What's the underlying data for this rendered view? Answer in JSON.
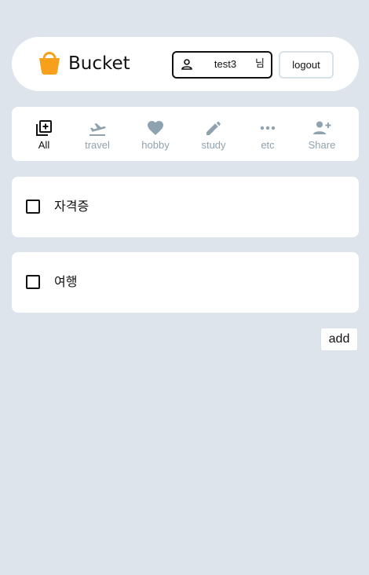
{
  "header": {
    "logo_icon": "bucket-icon",
    "logo_text": "Bucket",
    "user": {
      "icon": "person-icon",
      "name": "test3",
      "suffix": "님"
    },
    "logout_label": "logout"
  },
  "categories": [
    {
      "label": "All",
      "icon": "add-box-icon",
      "active": true
    },
    {
      "label": "travel",
      "icon": "airplane-takeoff-icon",
      "active": false
    },
    {
      "label": "hobby",
      "icon": "heart-icon",
      "active": false
    },
    {
      "label": "study",
      "icon": "pencil-icon",
      "active": false
    },
    {
      "label": "etc",
      "icon": "more-horizontal-icon",
      "active": false
    },
    {
      "label": "Share",
      "icon": "person-add-icon",
      "active": false
    }
  ],
  "items": [
    {
      "text": "자격증",
      "checked": false
    },
    {
      "text": "여행",
      "checked": false
    }
  ],
  "add_label": "add",
  "colors": {
    "background": "#dde4ec",
    "accent": "#f7a01c",
    "inactive": "#8fa2b0"
  }
}
